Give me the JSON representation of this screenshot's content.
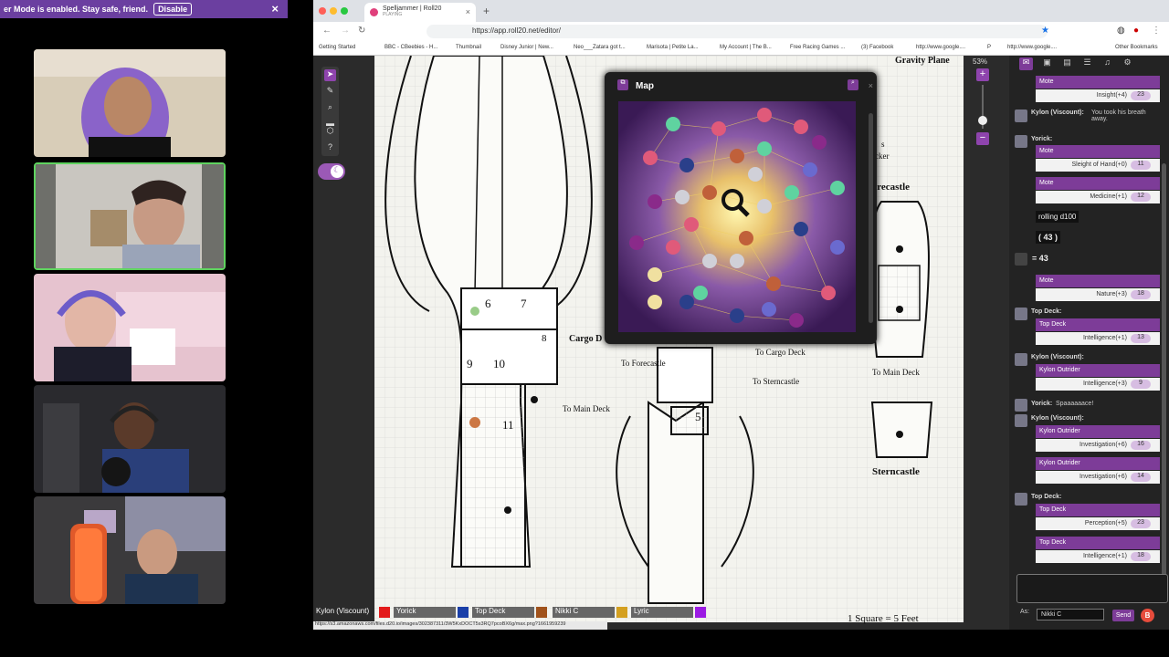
{
  "banner": {
    "text": "er Mode is enabled. Stay safe, friend.",
    "disable_label": "Disable",
    "close": "×"
  },
  "browser": {
    "tab_title": "Spelljammer | Roll20",
    "tab_sub": "PLAYING",
    "url": "https://app.roll20.net/editor/",
    "bookmarks": [
      "Getting Started",
      "BBC - CBeebies - H...",
      "Thumbnail",
      "Disney Junior | New...",
      "Neo___Zatara got t...",
      "Marisota | Petite La...",
      "My Account | The B...",
      "Free Racing Games ...",
      "(3) Facebook",
      "http://www.google....",
      "P",
      "http://www.google....",
      "Other Bookmarks"
    ]
  },
  "zoom": {
    "level": "53%"
  },
  "map_dialog": {
    "title": "Map"
  },
  "map_labels": {
    "gravity_plane": "Gravity Plane",
    "forecastle": "Forecastle",
    "sterncastle": "Sterncastle",
    "cargo_deck": "Cargo D",
    "to_cargo_deck": "To Cargo Deck",
    "to_forecastle": "To Forecastle",
    "to_sterncastle": "To Sterncastle",
    "to_main_deck_a": "To Main Deck",
    "to_main_deck_b": "To Main Deck",
    "room6": "6",
    "room7": "7",
    "room8": "8",
    "room9": "9",
    "room10": "10",
    "room11": "11",
    "room5": "5",
    "scale": "1 Square = 5 Feet",
    "partial_s": "s",
    "partial_cker": "cker"
  },
  "players": [
    {
      "name": "Kylon (Viscount)",
      "color": "#e31b1b"
    },
    {
      "name": "Yorick",
      "color": "#1a3fa8"
    },
    {
      "name": "Top Deck",
      "color": "#a0521b"
    },
    {
      "name": "Nikki C",
      "color": "#d4a020"
    },
    {
      "name": "Lyric",
      "color": "#9b1be3"
    }
  ],
  "status_url": "https://s3.amazonaws.com/files.d20.io/images/302387311/3W5KxDOCT5s3RQ7pcoBX6g/max.png?1661959239",
  "chat": {
    "messages": [
      {
        "type": "roll",
        "title": "Mote",
        "label": "Insight(+4)",
        "value": "23"
      },
      {
        "type": "text",
        "who": "Kylon (Viscount):",
        "text": "You took his breath away."
      },
      {
        "type": "who",
        "who": "Yorick:"
      },
      {
        "type": "roll",
        "title": "Mote",
        "label": "Sleight of Hand(+0)",
        "value": "11"
      },
      {
        "type": "roll",
        "title": "Mote",
        "label": "Medicine(+1)",
        "value": "12"
      },
      {
        "type": "plain",
        "text": "rolling d100"
      },
      {
        "type": "plain",
        "text": "( 43 )"
      },
      {
        "type": "plain",
        "text": "= 43"
      },
      {
        "type": "roll",
        "title": "Mote",
        "label": "Nature(+3)",
        "value": "18"
      },
      {
        "type": "who",
        "who": "Top Deck:"
      },
      {
        "type": "roll",
        "title": "Top Deck",
        "label": "Intelligence(+1)",
        "value": "13"
      },
      {
        "type": "who",
        "who": "Kylon (Viscount):"
      },
      {
        "type": "roll",
        "title": "Kylon Outrider",
        "label": "Intelligence(+3)",
        "value": "9"
      },
      {
        "type": "text",
        "who": "Yorick:",
        "text": "Spaaaaaace!"
      },
      {
        "type": "who",
        "who": "Kylon (Viscount):"
      },
      {
        "type": "roll",
        "title": "Kylon Outrider",
        "label": "Investigation(+6)",
        "value": "16"
      },
      {
        "type": "roll",
        "title": "Kylon Outrider",
        "label": "Investigation(+6)",
        "value": "14"
      },
      {
        "type": "who",
        "who": "Top Deck:"
      },
      {
        "type": "roll",
        "title": "Top Deck",
        "label": "Perception(+5)",
        "value": "23"
      },
      {
        "type": "roll",
        "title": "Top Deck",
        "label": "Intelligence(+1)",
        "value": "18"
      }
    ],
    "as_label": "As:",
    "as_value": "Nikki C",
    "send_label": "Send",
    "beyond_label": "B"
  }
}
